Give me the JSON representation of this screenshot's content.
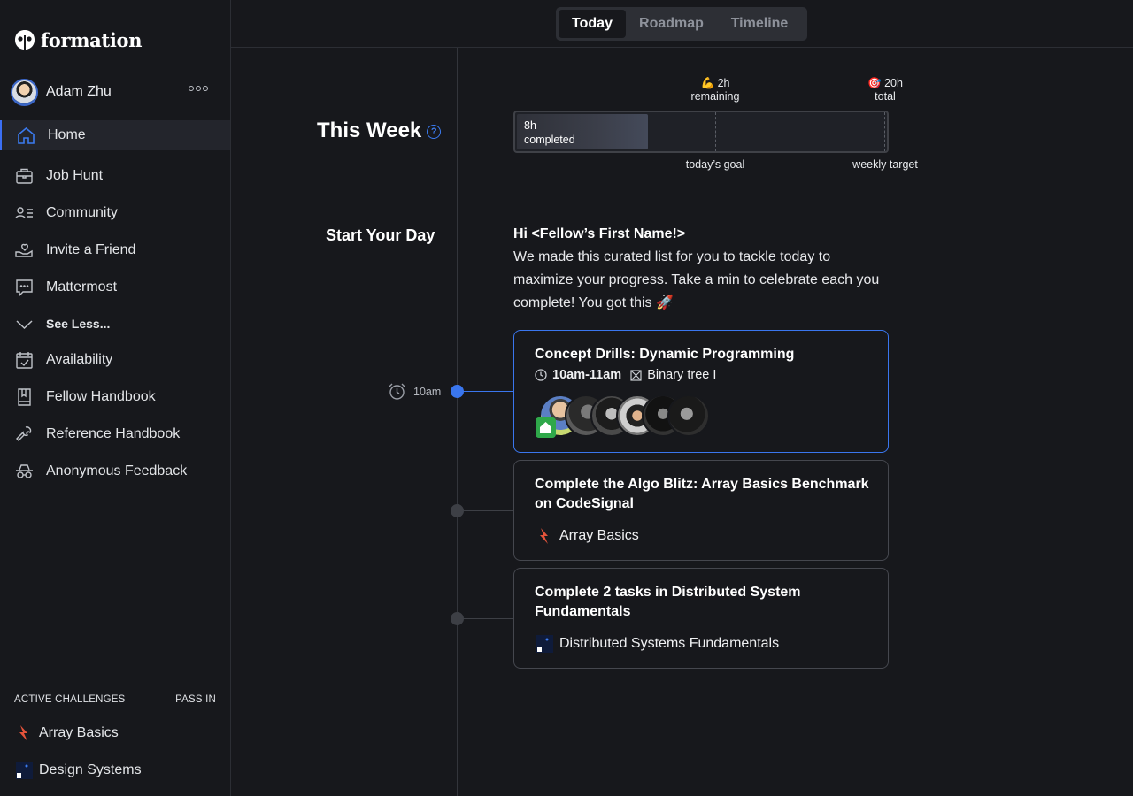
{
  "app": {
    "logo_text": "formation"
  },
  "user": {
    "name": "Adam Zhu"
  },
  "sidebar": {
    "items": [
      {
        "label": "Home",
        "icon": "home-icon"
      },
      {
        "label": "Job Hunt",
        "icon": "briefcase-icon"
      },
      {
        "label": "Community",
        "icon": "people-list-icon"
      },
      {
        "label": "Invite a Friend",
        "icon": "heart-hand-icon"
      },
      {
        "label": "Mattermost",
        "icon": "chat-bubble-icon"
      },
      {
        "label": "See Less...",
        "icon": "chevron-down-icon"
      },
      {
        "label": "Availability",
        "icon": "calendar-check-icon"
      },
      {
        "label": "Fellow Handbook",
        "icon": "book-icon"
      },
      {
        "label": "Reference Handbook",
        "icon": "wrench-icon"
      },
      {
        "label": "Anonymous Feedback",
        "icon": "incognito-icon"
      }
    ],
    "challenges_header": "ACTIVE CHALLENGES",
    "pass_in_label": "PASS IN",
    "challenges": [
      {
        "label": "Array Basics",
        "icon": "lightning-icon"
      },
      {
        "label": "Design Systems",
        "icon": "design-systems-icon"
      }
    ]
  },
  "tabs": [
    {
      "label": "Today"
    },
    {
      "label": "Roadmap"
    },
    {
      "label": "Timeline"
    }
  ],
  "this_week": {
    "title": "This Week",
    "help_glyph": "?",
    "completed_hours": "8h",
    "completed_label": "completed",
    "completed_fraction": 0.4,
    "remaining_emoji": "💪",
    "remaining_hours": "2h",
    "remaining_label": "remaining",
    "total_emoji": "🎯",
    "total_hours": "20h",
    "total_label": "total",
    "goal_label": "today’s goal",
    "target_label": "weekly target"
  },
  "start_day": {
    "title": "Start Your Day",
    "greeting": "Hi <Fellow’s First Name!>",
    "message": "We made this curated list for you to tackle today to maximize your progress. Take a min to celebrate each you complete! You got this 🚀"
  },
  "timeline": {
    "time_label": "10am"
  },
  "tasks": [
    {
      "title": "Concept Drills: Dynamic Programming",
      "time": "10am-11am",
      "topic": "Binary tree I",
      "accent": "#3a76ee"
    },
    {
      "title": "Complete the Algo Blitz: Array Basics Benchmark on CodeSignal",
      "tag": "Array Basics"
    },
    {
      "title": "Complete 2 tasks in Distributed System Fundamentals",
      "tag": "Distributed Systems Fundamentals"
    }
  ],
  "colors": {
    "accent": "#3a76ee",
    "background": "#17181c",
    "lightning": "#e5533b",
    "badge_green": "#2fa84a"
  }
}
